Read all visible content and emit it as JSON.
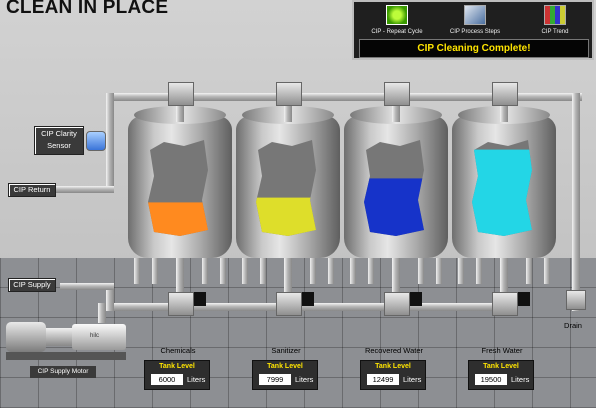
{
  "title": "CLEAN IN PLACE",
  "controls": {
    "buttons": [
      {
        "label": "CIP - Repeat Cycle",
        "icon": "repeat-cycle-icon"
      },
      {
        "label": "CIP Process Steps",
        "icon": "process-steps-icon"
      },
      {
        "label": "CIP Trend",
        "icon": "trend-icon"
      }
    ],
    "status": "CIP Cleaning Complete!"
  },
  "tags": {
    "clarity_sensor": "CIP Clarity\nSensor",
    "cip_return": "CIP Return",
    "cip_supply": "CIP Supply",
    "supply_motor": "CIP Supply Motor",
    "drain": "Drain",
    "pump_label": "hilc"
  },
  "tanks": [
    {
      "name": "Chemicals",
      "heading": "Tank Level",
      "value": "6000",
      "unit": "Liters",
      "fluid_color": "#ff8a1f",
      "fill": 0.35
    },
    {
      "name": "Sanitizer",
      "heading": "Tank Level",
      "value": "7999",
      "unit": "Liters",
      "fluid_color": "#dede2a",
      "fill": 0.4
    },
    {
      "name": "Recovered Water",
      "heading": "Tank Level",
      "value": "12499",
      "unit": "Liters",
      "fluid_color": "#1633c9",
      "fill": 0.6
    },
    {
      "name": "Fresh Water",
      "heading": "Tank Level",
      "value": "19500",
      "unit": "Liters",
      "fluid_color": "#23d6e6",
      "fill": 0.9
    }
  ]
}
